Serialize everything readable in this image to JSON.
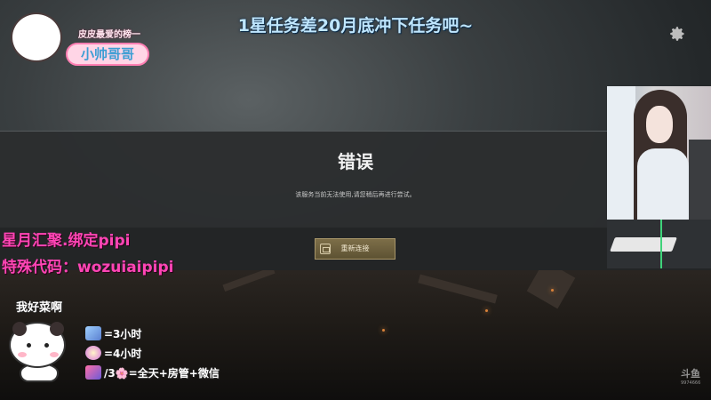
{
  "stream_title": "1星任务差20月底冲下任务吧~",
  "logo": {
    "subtitle": "皮皮最爱的榜一",
    "name": "小帅哥哥"
  },
  "dialog": {
    "title": "错误",
    "message": "该服务当前无法使用,请您稍后再进行尝试。",
    "button_label": "重新连接"
  },
  "promo": {
    "line1": "星月汇聚.绑定pipi",
    "line2": "特殊代码：wozuiaipipi"
  },
  "mascot": {
    "speech": "我好菜啊"
  },
  "legend": [
    {
      "icon": "blue-wing-badge-icon",
      "text": "=3小时"
    },
    {
      "icon": "flower-badge-icon",
      "text": "=4小时"
    },
    {
      "icon": "rocket-badge-icon",
      "text": "/3🌸=全天+房管+微信"
    }
  ],
  "watermark": {
    "brand": "斗鱼",
    "room_id": "9974666"
  },
  "colors": {
    "title": "#bfe6ff",
    "promo": "#ff45b5",
    "button": "#6d6040",
    "dialog_bg": "#2c2e2f"
  }
}
